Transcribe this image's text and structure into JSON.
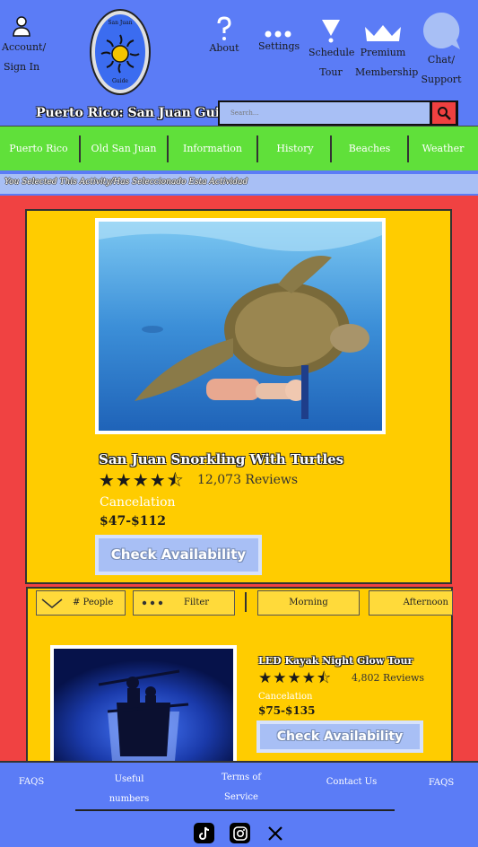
{
  "header": {
    "account_label": "Account/",
    "signin_label": "Sign In",
    "logo_top": "San Juan",
    "logo_bottom": "Guide",
    "site_title": "Puerto Rico: San Juan Guide",
    "about_label": "About",
    "settings_label": "Settings",
    "schedule_label_1": "Schedule",
    "schedule_label_2": "Tour",
    "premium_label_1": "Premium",
    "premium_label_2": "Membership",
    "chat_label_1": "Chat/",
    "chat_label_2": "Support",
    "search_placeholder": "Search...",
    "search_icon": "search-icon"
  },
  "nav": {
    "items": [
      "Puerto Rico",
      "Old San Juan",
      "Information",
      "History",
      "Beaches",
      "Weather"
    ]
  },
  "breadcrumb": "You Selected This Activity/Has Seleccionado Esta Actividad",
  "featured": {
    "title": "San Juan Snorkling With Turtles",
    "rating": 4.5,
    "stars": "★★★★⯪",
    "reviews": "12,073 Reviews",
    "cancelation": "Cancelation",
    "price": "$47-$112",
    "cta": "Check Availability"
  },
  "filters": {
    "people": "# People",
    "filter": "Filter",
    "morning": "Morning",
    "afternoon": "Afternoon"
  },
  "listing": {
    "title": "LED Kayak Night Glow Tour",
    "rating": 4.5,
    "stars": "★★★★⯪",
    "reviews": "4,802 Reviews",
    "cancelation": "Cancelation",
    "price": "$75-$135",
    "cta": "Check Availability"
  },
  "footer": {
    "faqs_left": "FAQS",
    "useful_1": "Useful",
    "useful_2": "numbers",
    "terms_1": "Terms of",
    "terms_2": "Service",
    "contact": "Contact Us",
    "faqs_right": "FAQS",
    "social_icons": [
      "tiktok-icon",
      "instagram-icon",
      "x-icon"
    ]
  },
  "colors": {
    "header_blue": "#5b7cf6",
    "nav_green": "#60e03a",
    "main_red": "#f04242",
    "card_yellow": "#ffcc00",
    "button_lightblue": "#a8bff5"
  }
}
